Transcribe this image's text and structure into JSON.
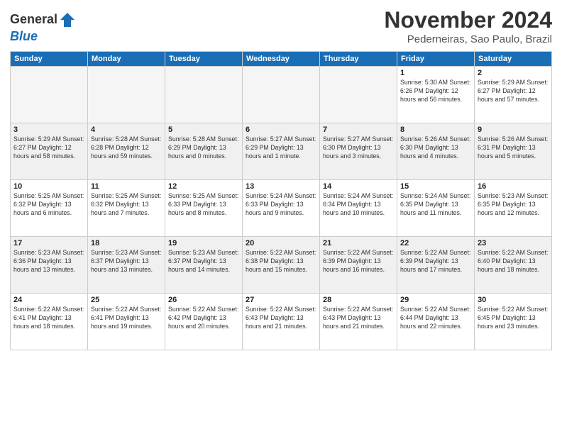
{
  "logo": {
    "line1": "General",
    "line2": "Blue"
  },
  "title": "November 2024",
  "location": "Pederneiras, Sao Paulo, Brazil",
  "days_of_week": [
    "Sunday",
    "Monday",
    "Tuesday",
    "Wednesday",
    "Thursday",
    "Friday",
    "Saturday"
  ],
  "weeks": [
    [
      {
        "day": "",
        "info": ""
      },
      {
        "day": "",
        "info": ""
      },
      {
        "day": "",
        "info": ""
      },
      {
        "day": "",
        "info": ""
      },
      {
        "day": "",
        "info": ""
      },
      {
        "day": "1",
        "info": "Sunrise: 5:30 AM\nSunset: 6:26 PM\nDaylight: 12 hours and 56 minutes."
      },
      {
        "day": "2",
        "info": "Sunrise: 5:29 AM\nSunset: 6:27 PM\nDaylight: 12 hours and 57 minutes."
      }
    ],
    [
      {
        "day": "3",
        "info": "Sunrise: 5:29 AM\nSunset: 6:27 PM\nDaylight: 12 hours and 58 minutes."
      },
      {
        "day": "4",
        "info": "Sunrise: 5:28 AM\nSunset: 6:28 PM\nDaylight: 12 hours and 59 minutes."
      },
      {
        "day": "5",
        "info": "Sunrise: 5:28 AM\nSunset: 6:29 PM\nDaylight: 13 hours and 0 minutes."
      },
      {
        "day": "6",
        "info": "Sunrise: 5:27 AM\nSunset: 6:29 PM\nDaylight: 13 hours and 1 minute."
      },
      {
        "day": "7",
        "info": "Sunrise: 5:27 AM\nSunset: 6:30 PM\nDaylight: 13 hours and 3 minutes."
      },
      {
        "day": "8",
        "info": "Sunrise: 5:26 AM\nSunset: 6:30 PM\nDaylight: 13 hours and 4 minutes."
      },
      {
        "day": "9",
        "info": "Sunrise: 5:26 AM\nSunset: 6:31 PM\nDaylight: 13 hours and 5 minutes."
      }
    ],
    [
      {
        "day": "10",
        "info": "Sunrise: 5:25 AM\nSunset: 6:32 PM\nDaylight: 13 hours and 6 minutes."
      },
      {
        "day": "11",
        "info": "Sunrise: 5:25 AM\nSunset: 6:32 PM\nDaylight: 13 hours and 7 minutes."
      },
      {
        "day": "12",
        "info": "Sunrise: 5:25 AM\nSunset: 6:33 PM\nDaylight: 13 hours and 8 minutes."
      },
      {
        "day": "13",
        "info": "Sunrise: 5:24 AM\nSunset: 6:33 PM\nDaylight: 13 hours and 9 minutes."
      },
      {
        "day": "14",
        "info": "Sunrise: 5:24 AM\nSunset: 6:34 PM\nDaylight: 13 hours and 10 minutes."
      },
      {
        "day": "15",
        "info": "Sunrise: 5:24 AM\nSunset: 6:35 PM\nDaylight: 13 hours and 11 minutes."
      },
      {
        "day": "16",
        "info": "Sunrise: 5:23 AM\nSunset: 6:35 PM\nDaylight: 13 hours and 12 minutes."
      }
    ],
    [
      {
        "day": "17",
        "info": "Sunrise: 5:23 AM\nSunset: 6:36 PM\nDaylight: 13 hours and 13 minutes."
      },
      {
        "day": "18",
        "info": "Sunrise: 5:23 AM\nSunset: 6:37 PM\nDaylight: 13 hours and 13 minutes."
      },
      {
        "day": "19",
        "info": "Sunrise: 5:23 AM\nSunset: 6:37 PM\nDaylight: 13 hours and 14 minutes."
      },
      {
        "day": "20",
        "info": "Sunrise: 5:22 AM\nSunset: 6:38 PM\nDaylight: 13 hours and 15 minutes."
      },
      {
        "day": "21",
        "info": "Sunrise: 5:22 AM\nSunset: 6:39 PM\nDaylight: 13 hours and 16 minutes."
      },
      {
        "day": "22",
        "info": "Sunrise: 5:22 AM\nSunset: 6:39 PM\nDaylight: 13 hours and 17 minutes."
      },
      {
        "day": "23",
        "info": "Sunrise: 5:22 AM\nSunset: 6:40 PM\nDaylight: 13 hours and 18 minutes."
      }
    ],
    [
      {
        "day": "24",
        "info": "Sunrise: 5:22 AM\nSunset: 6:41 PM\nDaylight: 13 hours and 18 minutes."
      },
      {
        "day": "25",
        "info": "Sunrise: 5:22 AM\nSunset: 6:41 PM\nDaylight: 13 hours and 19 minutes."
      },
      {
        "day": "26",
        "info": "Sunrise: 5:22 AM\nSunset: 6:42 PM\nDaylight: 13 hours and 20 minutes."
      },
      {
        "day": "27",
        "info": "Sunrise: 5:22 AM\nSunset: 6:43 PM\nDaylight: 13 hours and 21 minutes."
      },
      {
        "day": "28",
        "info": "Sunrise: 5:22 AM\nSunset: 6:43 PM\nDaylight: 13 hours and 21 minutes."
      },
      {
        "day": "29",
        "info": "Sunrise: 5:22 AM\nSunset: 6:44 PM\nDaylight: 13 hours and 22 minutes."
      },
      {
        "day": "30",
        "info": "Sunrise: 5:22 AM\nSunset: 6:45 PM\nDaylight: 13 hours and 23 minutes."
      }
    ]
  ]
}
